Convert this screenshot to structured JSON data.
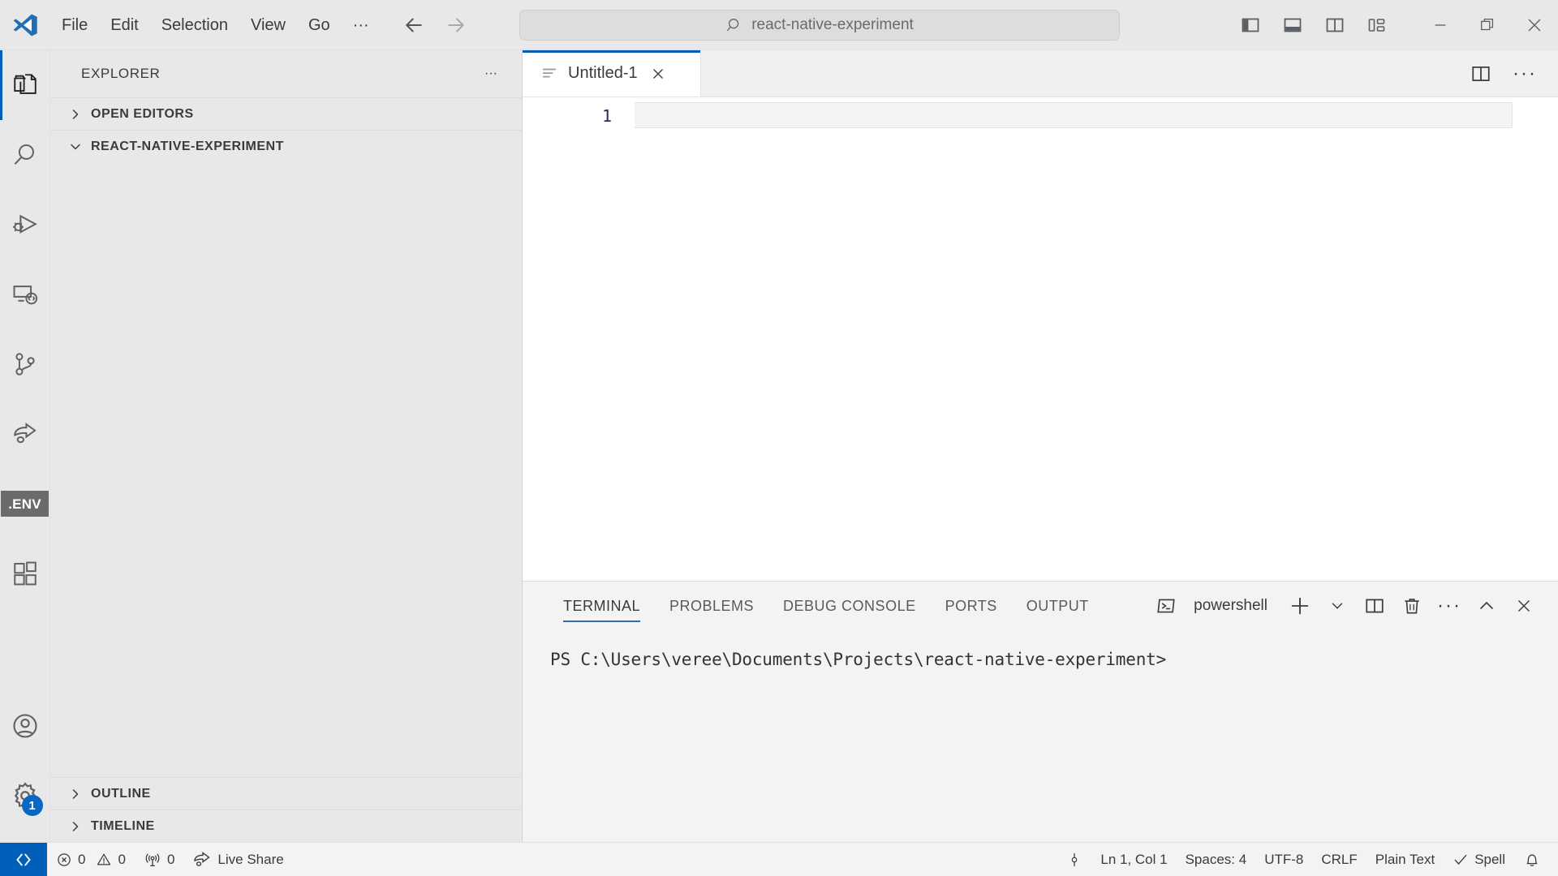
{
  "titlebar": {
    "menu": [
      {
        "label": "File",
        "name": "menu-file"
      },
      {
        "label": "Edit",
        "name": "menu-edit"
      },
      {
        "label": "Selection",
        "name": "menu-selection"
      },
      {
        "label": "View",
        "name": "menu-view"
      },
      {
        "label": "Go",
        "name": "menu-go"
      }
    ],
    "more_label": "···",
    "search_text": "react-native-experiment",
    "search_icon": "search-icon",
    "back_icon": "arrow-left-icon",
    "forward_icon": "arrow-right-icon",
    "layout_toggles": [
      {
        "name": "toggle-primary-sidebar-icon"
      },
      {
        "name": "toggle-panel-icon"
      },
      {
        "name": "toggle-secondary-sidebar-icon"
      },
      {
        "name": "customize-layout-icon"
      }
    ],
    "window": {
      "minimize": "minimize-icon",
      "maximize": "maximize-icon",
      "close": "close-icon"
    }
  },
  "activitybar": {
    "items": [
      {
        "label": "Explorer",
        "name": "activity-explorer",
        "active": true
      },
      {
        "label": "Search",
        "name": "activity-search",
        "active": false
      },
      {
        "label": "Run and Debug",
        "name": "activity-run-debug",
        "active": false
      },
      {
        "label": "Remote Explorer",
        "name": "activity-remote-explorer",
        "active": false
      },
      {
        "label": "Source Control",
        "name": "activity-source-control",
        "active": false
      },
      {
        "label": "Live Share",
        "name": "activity-live-share",
        "active": false
      },
      {
        "label": ".ENV",
        "name": "activity-dotenv",
        "active": false
      },
      {
        "label": "Extensions",
        "name": "activity-extensions",
        "active": false
      }
    ],
    "bottom": [
      {
        "label": "Accounts",
        "name": "activity-accounts"
      },
      {
        "label": "Manage",
        "name": "activity-manage",
        "badge": "1"
      }
    ],
    "badge_color": "#0a67c2",
    "active_color": "#005fb8"
  },
  "sidebar": {
    "title": "EXPLORER",
    "more_label": "···",
    "sections": [
      {
        "label": "OPEN EDITORS",
        "expanded": false,
        "name": "section-open-editors"
      },
      {
        "label": "REACT-NATIVE-EXPERIMENT",
        "expanded": true,
        "name": "section-workspace-folder"
      }
    ],
    "footer_sections": [
      {
        "label": "OUTLINE",
        "expanded": false,
        "name": "section-outline"
      },
      {
        "label": "TIMELINE",
        "expanded": false,
        "name": "section-timeline"
      }
    ]
  },
  "editor": {
    "tabs": [
      {
        "label": "Untitled-1",
        "active": true,
        "icon": "plain-text-file-icon",
        "name": "tab-untitled-1"
      }
    ],
    "close_icon": "close-icon",
    "actions": [
      {
        "name": "split-editor-right-icon"
      },
      {
        "name": "more-actions-icon",
        "label": "···"
      }
    ],
    "line_numbers": [
      "1"
    ],
    "content": ""
  },
  "panel": {
    "tabs": [
      {
        "label": "TERMINAL",
        "active": true,
        "name": "panel-tab-terminal"
      },
      {
        "label": "PROBLEMS",
        "active": false,
        "name": "panel-tab-problems"
      },
      {
        "label": "DEBUG CONSOLE",
        "active": false,
        "name": "panel-tab-debug-console"
      },
      {
        "label": "PORTS",
        "active": false,
        "name": "panel-tab-ports"
      },
      {
        "label": "OUTPUT",
        "active": false,
        "name": "panel-tab-output"
      }
    ],
    "terminal_name": "powershell",
    "actions": [
      {
        "name": "new-terminal-icon"
      },
      {
        "name": "terminal-dropdown-icon"
      },
      {
        "name": "split-terminal-icon"
      },
      {
        "name": "kill-terminal-icon"
      },
      {
        "name": "panel-more-actions-icon",
        "label": "···"
      },
      {
        "name": "maximize-panel-icon"
      },
      {
        "name": "close-panel-icon"
      }
    ],
    "terminal_prompt": "PS C:\\Users\\veree\\Documents\\Projects\\react-native-experiment>",
    "active_underline_color": "#3c69a8"
  },
  "statusbar": {
    "remote_icon": "remote-window-icon",
    "left": [
      {
        "label": "0",
        "icon": "error-icon",
        "name": "status-errors"
      },
      {
        "label": "0",
        "icon": "warning-icon",
        "name": "status-warnings"
      },
      {
        "label": "0",
        "icon": "ports-icon",
        "name": "status-ports"
      },
      {
        "label": "Live Share",
        "icon": "live-share-icon",
        "name": "status-live-share"
      }
    ],
    "right": [
      {
        "label": "",
        "icon": "pin-icon",
        "name": "status-pin"
      },
      {
        "label": "Ln 1, Col 1",
        "name": "status-cursor-position"
      },
      {
        "label": "Spaces: 4",
        "name": "status-indentation"
      },
      {
        "label": "UTF-8",
        "name": "status-encoding"
      },
      {
        "label": "CRLF",
        "name": "status-eol"
      },
      {
        "label": "Plain Text",
        "name": "status-language-mode"
      },
      {
        "label": "Spell",
        "icon": "check-icon",
        "name": "status-spell"
      },
      {
        "label": "",
        "icon": "bell-icon",
        "name": "status-notifications"
      }
    ],
    "remote_color": "#005fb8"
  }
}
